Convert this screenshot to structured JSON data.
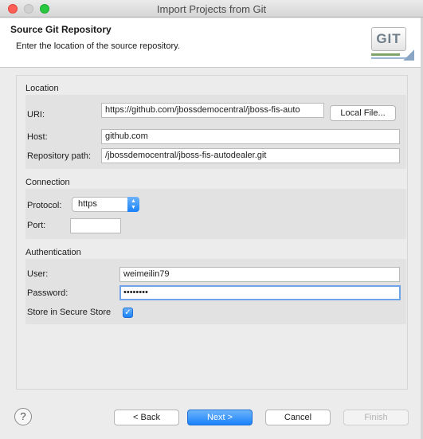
{
  "window": {
    "title": "Import Projects from Git"
  },
  "header": {
    "title": "Source Git Repository",
    "description": "Enter the location of the source repository.",
    "logo_text": "GIT"
  },
  "location": {
    "group_label": "Location",
    "uri_label": "URI:",
    "uri_value": "https://github.com/jbossdemocentral/jboss-fis-auto",
    "local_file_label": "Local File...",
    "host_label": "Host:",
    "host_value": "github.com",
    "repo_path_label": "Repository path:",
    "repo_path_value": "/jbossdemocentral/jboss-fis-autodealer.git"
  },
  "connection": {
    "group_label": "Connection",
    "protocol_label": "Protocol:",
    "protocol_value": "https",
    "port_label": "Port:",
    "port_value": ""
  },
  "authentication": {
    "group_label": "Authentication",
    "user_label": "User:",
    "user_value": "weimeilin79",
    "password_label": "Password:",
    "password_value": "••••••••",
    "secure_store_label": "Store in Secure Store",
    "secure_store_checked": true
  },
  "footer": {
    "help_icon": "?",
    "back_label": "< Back",
    "next_label": "Next >",
    "cancel_label": "Cancel",
    "finish_label": "Finish"
  },
  "colors": {
    "accent": "#1a82fb",
    "focus_ring": "#6fa5e8",
    "close": "#ff5f57",
    "maximize": "#28c940"
  }
}
